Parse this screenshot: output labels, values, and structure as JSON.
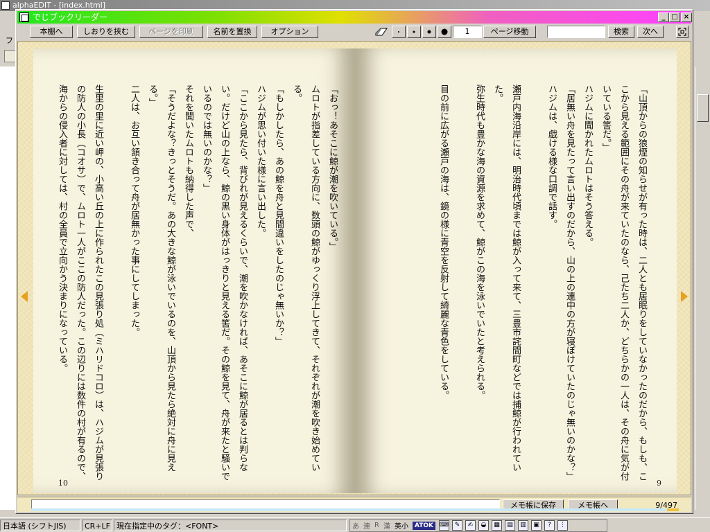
{
  "background_app": {
    "title": "alphaEDIT - [index.html]",
    "status": {
      "language": "日本語 (シフトJIS)",
      "line_ending": "CR+LF",
      "tag": "現在指定中のタグ：<FONT>"
    },
    "ime": [
      "あ",
      "連",
      "R",
      "漢",
      "英小",
      "ATOK"
    ]
  },
  "reader": {
    "title": "でじブックリーダー",
    "toolbar": {
      "shelf_button": "本棚へ",
      "bookmark_button": "しおりを挟む",
      "print_button": "ページを印刷",
      "rename_button": "名前を置換",
      "options_button": "オプション",
      "page_input": "1",
      "goto_button": "ページ移動",
      "search_input": "",
      "search_button": "検索",
      "next_button": "次へ"
    },
    "right_page": {
      "number": "9",
      "paragraphs": [
        "「山頂からの狼煙の知らせが有った時は、二人とも居眠りをしていなかったのだから、もしも、ここから見える範囲にその舟が来ていたのなら、己たち二人か、どちらかの一人は、その舟に気が付いている筈だ。」",
        "ハジムに聞かれたムロトはそう答える。",
        "「居無い舟を見たって言い出すのだから、山の上の連中の方が寝ぼけていたのじゃ無いのかな？」",
        "ハジムは、戯ける様な口調で話す。",
        "",
        "瀬戸内海沿岸には、明治時代頃までは鯨が入って来て、三豊市詫間町などでは捕鯨が行われていた。",
        "弥生時代も豊かな海の資源を求めて、鯨がこの海を泳いでいたと考えられる。",
        "",
        "目の前に広がる瀬戸の海は、鏡の様に青空を反射して綺麗な青色をしている。"
      ]
    },
    "left_page": {
      "number": "10",
      "paragraphs": [
        "「おっ！あそこに鯨が潮を吹いている。」",
        "ムロトが指差している方向に、数頭の鯨がゆっくり浮上してきて、それぞれが潮を吹き始めている。",
        "「もしかしたら、あの鯨を舟と見間違いをしたのじゃ無いか？」",
        "ハジムが思い付いた様に言い出した。",
        "「ここから見たら、背びれが見えるくらいで、潮を吹かなければ、あそこに鯨が居るとは判らない。だけど山の上なら、鯨の黒い身体がはっきりと見える筈だ。その鯨を見て、舟が来たと騒いでいるのでは無いのかな？」",
        "それを聞いたムロトも納得した声で、",
        "「そうだよな？きっとそうだ。あの大きな鯨が泳いでいるのを、山頂から見たら絶対に舟に見える。」",
        "二人は、お互い頷き合って舟が居無かった事にしてしまった。",
        "",
        "生里の里に近い岬の、小高い丘の上に作られたこの見張り処（ミハリドコロ）は、ハジムが見張りの防人の小長（コオサ）で、ムロト一人がここの防人だった。この辺りには数件の村が有るので、海からの侵入者に対しては、村の全員で立向かう決まりになっている。"
      ]
    },
    "memo": {
      "input": "",
      "save_button": "メモ帳に保存",
      "open_button": "メモ帳へ",
      "page_count": "9/497",
      "progress": 0.018
    }
  }
}
